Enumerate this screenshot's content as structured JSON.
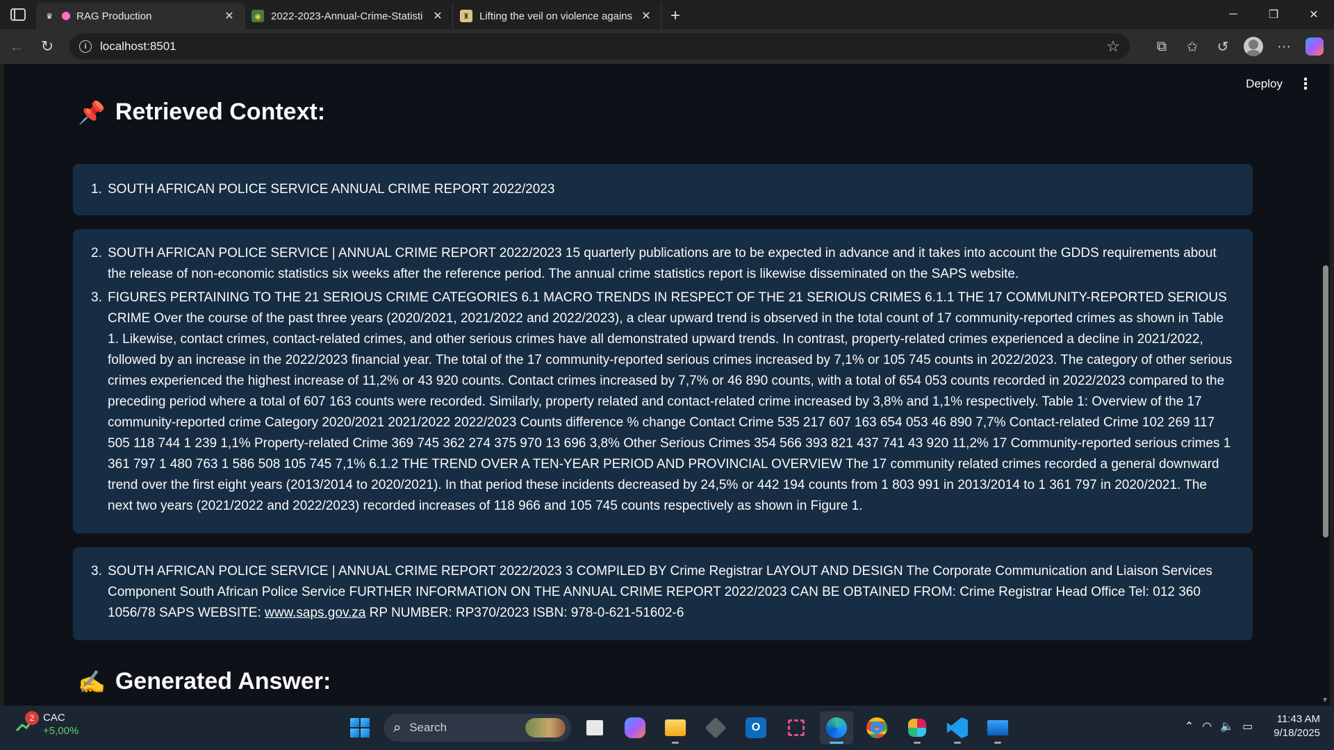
{
  "browser": {
    "tabs": [
      {
        "title": "RAG Production",
        "favicon": "streamlit-icon",
        "active": true
      },
      {
        "title": "2022-2023-Annual-Crime-Statisti",
        "favicon": "document-icon",
        "active": false
      },
      {
        "title": "Lifting the veil on violence agains",
        "favicon": "article-icon",
        "active": false
      }
    ],
    "url": "localhost:8501"
  },
  "app": {
    "header": {
      "deploy_label": "Deploy"
    },
    "retrieved": {
      "emoji": "📌",
      "title": "Retrieved Context:",
      "cards": [
        {
          "items": [
            {
              "num": "1.",
              "text": "SOUTH AFRICAN POLICE SERVICE ANNUAL CRIME REPORT 2022/2023"
            }
          ]
        },
        {
          "items": [
            {
              "num": "2.",
              "text": "SOUTH AFRICAN POLICE SERVICE | ANNUAL CRIME REPORT 2022/2023 15 quarterly publications are to be expected in advance and it takes into account the GDDS requirements about the release of non-economic statistics six weeks after the reference period. The annual crime statistics report is likewise disseminated on the SAPS website."
            },
            {
              "num": "3.",
              "text": "FIGURES PERTAINING TO THE 21 SERIOUS CRIME CATEGORIES 6.1 MACRO TRENDS IN RESPECT OF THE 21 SERIOUS CRIMES 6.1.1 THE 17 COMMUNITY-REPORTED SERIOUS CRIME Over the course of the past three years (2020/2021, 2021/2022 and 2022/2023), a clear upward trend is observed in the total count of 17 community-reported crimes as shown in Table 1. Likewise, contact crimes, contact-related crimes, and other serious crimes have all demonstrated upward trends. In contrast, property-related crimes experienced a decline in 2021/2022, followed by an increase in the 2022/2023 financial year. The total of the 17 community-reported serious crimes increased by 7,1% or 105 745 counts in 2022/2023. The category of other serious crimes experienced the highest increase of 11,2% or 43 920 counts. Contact crimes increased by 7,7% or 46 890 counts, with a total of 654 053 counts recorded in 2022/2023 compared to the preceding period where a total of 607 163 counts were recorded. Similarly, property related and contact-related crime increased by 3,8% and 1,1% respectively. Table 1: Overview of the 17 community-reported crime Category 2020/2021 2021/2022 2022/2023 Counts difference % change Contact Crime 535 217 607 163 654 053 46 890 7,7% Contact-related Crime 102 269 117 505 118 744 1 239 1,1% Property-related Crime 369 745 362 274 375 970 13 696 3,8% Other Serious Crimes 354 566 393 821 437 741 43 920 11,2% 17 Community-reported serious crimes 1 361 797 1 480 763 1 586 508 105 745 7,1% 6.1.2 THE TREND OVER A TEN-YEAR PERIOD AND PROVINCIAL OVERVIEW The 17 community related crimes recorded a general downward trend over the first eight years (2013/2014 to 2020/2021). In that period these incidents decreased by 24,5% or 442 194 counts from 1 803 991 in 2013/2014 to 1 361 797 in 2020/2021. The next two years (2021/2022 and 2022/2023) recorded increases of 118 966 and 105 745 counts respectively as shown in Figure 1."
            }
          ]
        },
        {
          "items": [
            {
              "num": "3.",
              "text_before": "SOUTH AFRICAN POLICE SERVICE | ANNUAL CRIME REPORT 2022/2023 3 COMPILED BY Crime Registrar LAYOUT AND DESIGN The Corporate Communication and Liaison Services Component South African Police Service FURTHER INFORMATION ON THE ANNUAL CRIME REPORT 2022/2023 CAN BE OBTAINED FROM: Crime Registrar Head Office Tel: 012 360 1056/78 SAPS WEBSITE: ",
              "link": "www.saps.gov.za",
              "text_after": " RP NUMBER: RP370/2023 ISBN: 978-0-621-51602-6"
            }
          ]
        }
      ]
    },
    "answer": {
      "emoji": "✍️",
      "title": "Generated Answer:"
    }
  },
  "taskbar": {
    "stock": {
      "badge": "2",
      "name": "CAC",
      "change": "+5,00%"
    },
    "search_placeholder": "Search",
    "time": "11:43 AM",
    "date": "9/18/2025"
  }
}
